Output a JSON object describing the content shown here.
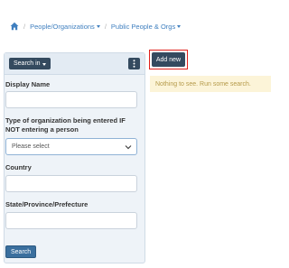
{
  "breadcrumb": {
    "home_icon": "home-icon",
    "items": [
      {
        "label": "People/Organizations"
      },
      {
        "label": "Public People & Orgs"
      }
    ]
  },
  "search_panel": {
    "search_in_label": "Search in",
    "menu_icon": "kebab-icon",
    "fields": {
      "display_name": {
        "label": "Display Name",
        "value": ""
      },
      "org_type": {
        "label": "Type of organization being entered IF NOT entering a person",
        "selected": "Please select"
      },
      "country": {
        "label": "Country",
        "value": ""
      },
      "state": {
        "label": "State/Province/Prefecture",
        "value": ""
      }
    },
    "search_button": "Search"
  },
  "main": {
    "add_new_button": "Add new",
    "empty_message": "Nothing to see. Run some search."
  },
  "colors": {
    "accent": "#344a5f",
    "link": "#3f7fbf",
    "highlight_frame": "#e0201b",
    "notice_bg": "#fcf4d8",
    "notice_text": "#b59a4a"
  }
}
